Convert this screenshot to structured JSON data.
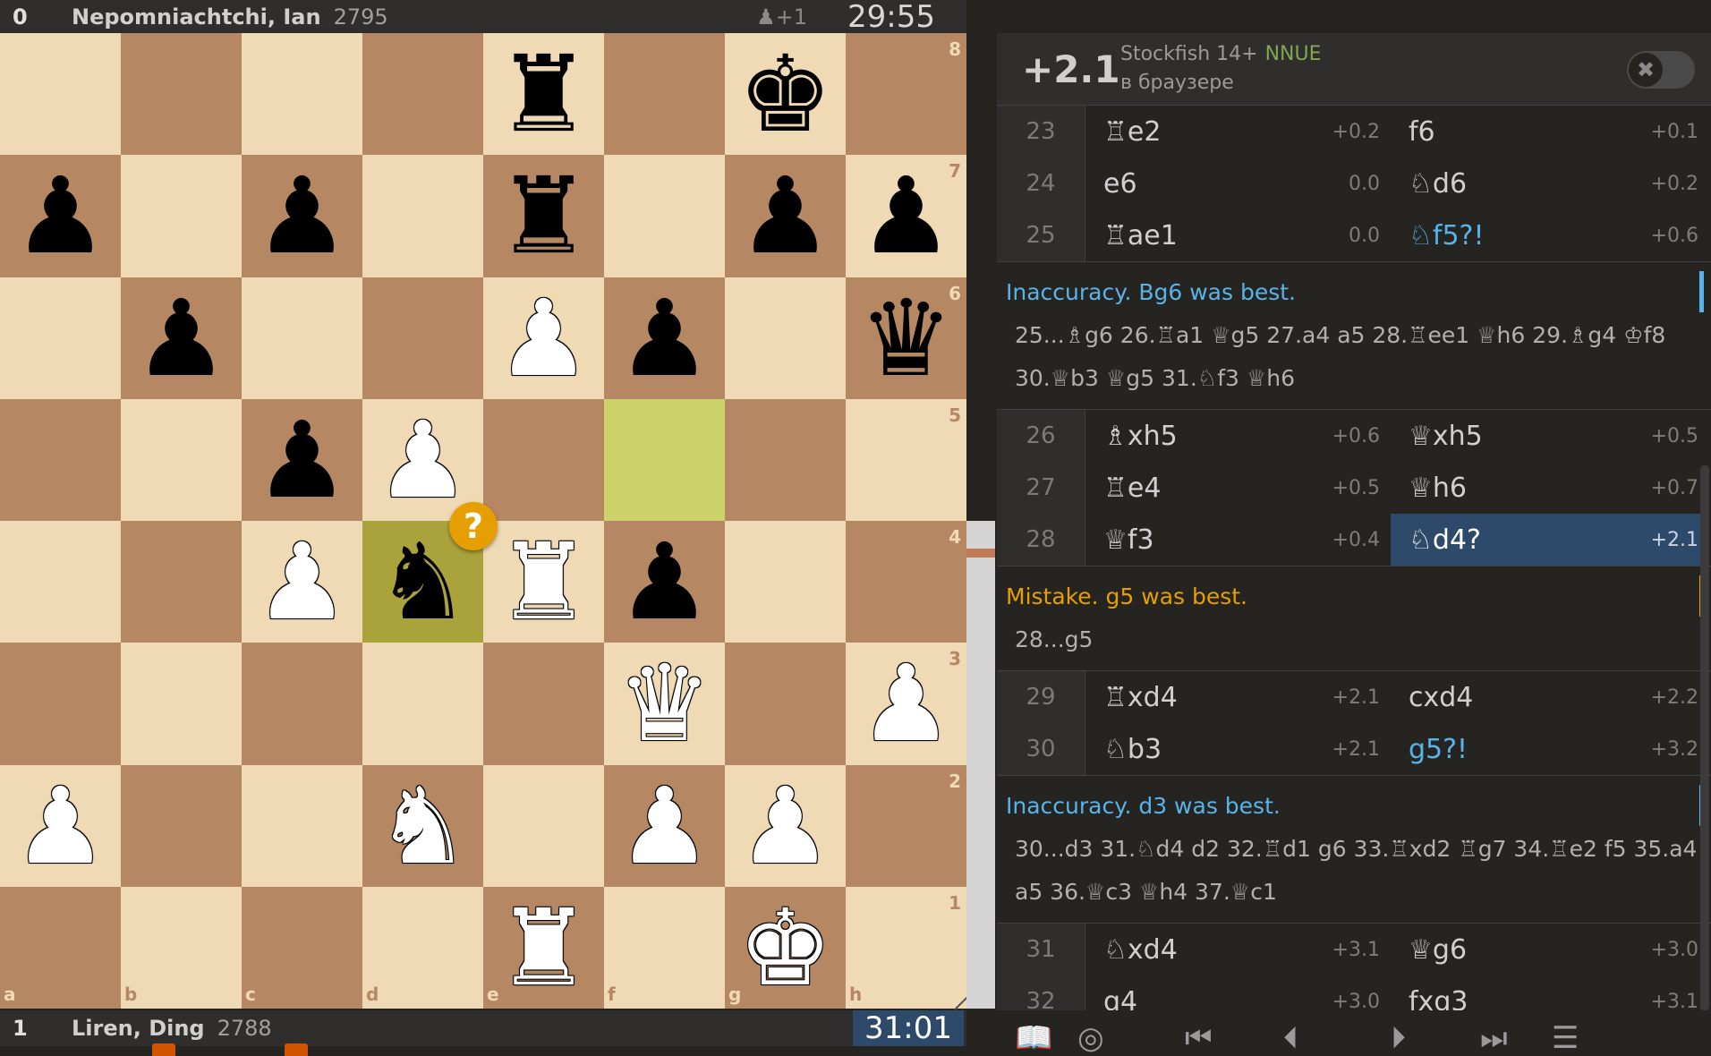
{
  "top_player": {
    "score": "0",
    "name": "Nepomniachtchi, Ian",
    "rating": "2795",
    "material": "♟+1",
    "clock": "29:55"
  },
  "bottom_player": {
    "score": "1",
    "name": "Liren, Ding",
    "rating": "2788",
    "clock": "31:01"
  },
  "board": {
    "light_color": "#f0d9b5",
    "dark_color": "#b58863",
    "highlight_light": "#cdd26a",
    "highlight_dark": "#aaa23a",
    "annotation_badge": "?",
    "highlighted_squares": [
      "f5",
      "d4"
    ],
    "files": [
      "a",
      "b",
      "c",
      "d",
      "e",
      "f",
      "g",
      "h"
    ],
    "ranks": [
      "8",
      "7",
      "6",
      "5",
      "4",
      "3",
      "2",
      "1"
    ],
    "position": [
      [
        "",
        "",
        "",
        "",
        "br",
        "",
        "bk",
        ""
      ],
      [
        "bp",
        "",
        "bp",
        "",
        "br",
        "",
        "bp",
        "bp"
      ],
      [
        "",
        "bp",
        "",
        "",
        "wp",
        "bp",
        "",
        "bq"
      ],
      [
        "",
        "",
        "bp",
        "wp",
        "",
        "",
        "",
        ""
      ],
      [
        "",
        "",
        "wp",
        "bn",
        "wr",
        "bp",
        "",
        ""
      ],
      [
        "",
        "",
        "",
        "",
        "",
        "wq",
        "",
        "wp"
      ],
      [
        "wp",
        "",
        "",
        "wn",
        "",
        "wp",
        "wp",
        ""
      ],
      [
        "",
        "",
        "",
        "",
        "wr",
        "",
        "wk",
        ""
      ]
    ]
  },
  "eval_gauge": {
    "white_fraction": 0.5
  },
  "engine": {
    "eval": "+2.1",
    "name": "Stockfish 14+",
    "tag": "NNUE",
    "sub": "в браузере",
    "toggle_icon": "✖"
  },
  "moves": [
    {
      "type": "row",
      "num": "23",
      "white": "♖e2",
      "white_eval": "+0.2",
      "black": "f6",
      "black_eval": "+0.1"
    },
    {
      "type": "row",
      "num": "24",
      "white": "e6",
      "white_eval": "0.0",
      "black": "♘d6",
      "black_eval": "+0.2"
    },
    {
      "type": "row",
      "num": "25",
      "white": "♖ae1",
      "white_eval": "0.0",
      "black": "♘f5?!",
      "black_eval": "+0.6",
      "black_class": "inacc"
    },
    {
      "type": "comment",
      "kind": "inaccuracy",
      "title": "Inaccuracy. Bg6 was best.",
      "line": "25...♗g6 26.♖a1 ♕g5 27.a4 a5 28.♖ee1 ♕h6 29.♗g4 ♔f8 30.♕b3 ♕g5 31.♘f3 ♕h6"
    },
    {
      "type": "row",
      "num": "26",
      "white": "♗xh5",
      "white_eval": "+0.6",
      "black": "♕xh5",
      "black_eval": "+0.5"
    },
    {
      "type": "row",
      "num": "27",
      "white": "♖e4",
      "white_eval": "+0.5",
      "black": "♕h6",
      "black_eval": "+0.7"
    },
    {
      "type": "row",
      "num": "28",
      "white": "♕f3",
      "white_eval": "+0.4",
      "black": "♘d4?",
      "black_eval": "+2.1",
      "black_class": "sel"
    },
    {
      "type": "comment",
      "kind": "mistake",
      "title": "Mistake. g5 was best.",
      "line": "28...g5"
    },
    {
      "type": "row",
      "num": "29",
      "white": "♖xd4",
      "white_eval": "+2.1",
      "black": "cxd4",
      "black_eval": "+2.2"
    },
    {
      "type": "row",
      "num": "30",
      "white": "♘b3",
      "white_eval": "+2.1",
      "black": "g5?!",
      "black_eval": "+3.2",
      "black_class": "inacc"
    },
    {
      "type": "comment",
      "kind": "inaccuracy",
      "title": "Inaccuracy. d3 was best.",
      "line": "30...d3 31.♘d4 d2 32.♖d1 g6 33.♖xd2 ♖g7 34.♖e2 f5 35.a4 a5 36.♕c3 ♕h4 37.♕c1"
    },
    {
      "type": "row",
      "num": "31",
      "white": "♘xd4",
      "white_eval": "+3.1",
      "black": "♕g6",
      "black_eval": "+3.0"
    },
    {
      "type": "row",
      "num": "32",
      "white": "g4",
      "white_eval": "+3.0",
      "black": "fxg3",
      "black_eval": "+3.1"
    }
  ],
  "controls": [
    {
      "name": "book-icon",
      "glyph": "📖"
    },
    {
      "name": "target-icon",
      "glyph": "◎"
    },
    {
      "name": "first-move-icon",
      "glyph": "⏮"
    },
    {
      "name": "prev-move-icon",
      "glyph": "⏴"
    },
    {
      "name": "next-move-icon",
      "glyph": "⏵"
    },
    {
      "name": "last-move-icon",
      "glyph": "⏭"
    },
    {
      "name": "menu-icon",
      "glyph": "☰"
    }
  ]
}
